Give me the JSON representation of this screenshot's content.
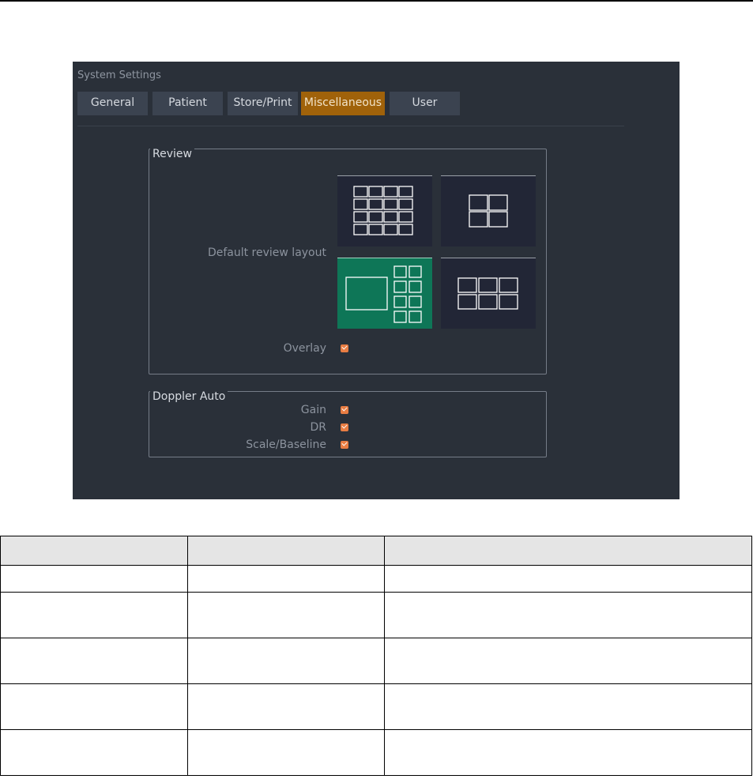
{
  "window": {
    "title": "System Settings"
  },
  "tabs": [
    {
      "label": "General",
      "active": false
    },
    {
      "label": "Patient",
      "active": false
    },
    {
      "label": "Store/Print",
      "active": false
    },
    {
      "label": "Miscellaneous",
      "active": true
    },
    {
      "label": "User",
      "active": false
    }
  ],
  "review": {
    "legend": "Review",
    "default_layout_label": "Default review layout",
    "layouts": [
      {
        "name": "4x4 grid",
        "selected": false
      },
      {
        "name": "2x2 grid",
        "selected": false
      },
      {
        "name": "1 large + 8 small",
        "selected": true
      },
      {
        "name": "3x2 grid",
        "selected": false
      }
    ],
    "overlay_label": "Overlay",
    "overlay_checked": true
  },
  "doppler_auto": {
    "legend": "Doppler Auto",
    "options": [
      {
        "label": "Gain",
        "checked": true
      },
      {
        "label": "DR",
        "checked": true
      },
      {
        "label": "Scale/Baseline",
        "checked": true
      }
    ]
  },
  "colors": {
    "background": "#2a3039",
    "active_tab": "#a0620a",
    "selected_layout": "#0e7657",
    "checkbox": "#e87d43"
  },
  "reference_table": {
    "headers": [
      "",
      "",
      ""
    ],
    "rows": [
      [
        "",
        "",
        ""
      ],
      [
        "",
        "",
        ""
      ],
      [
        "",
        "",
        ""
      ],
      [
        "",
        "",
        ""
      ],
      [
        "",
        "",
        ""
      ]
    ]
  }
}
